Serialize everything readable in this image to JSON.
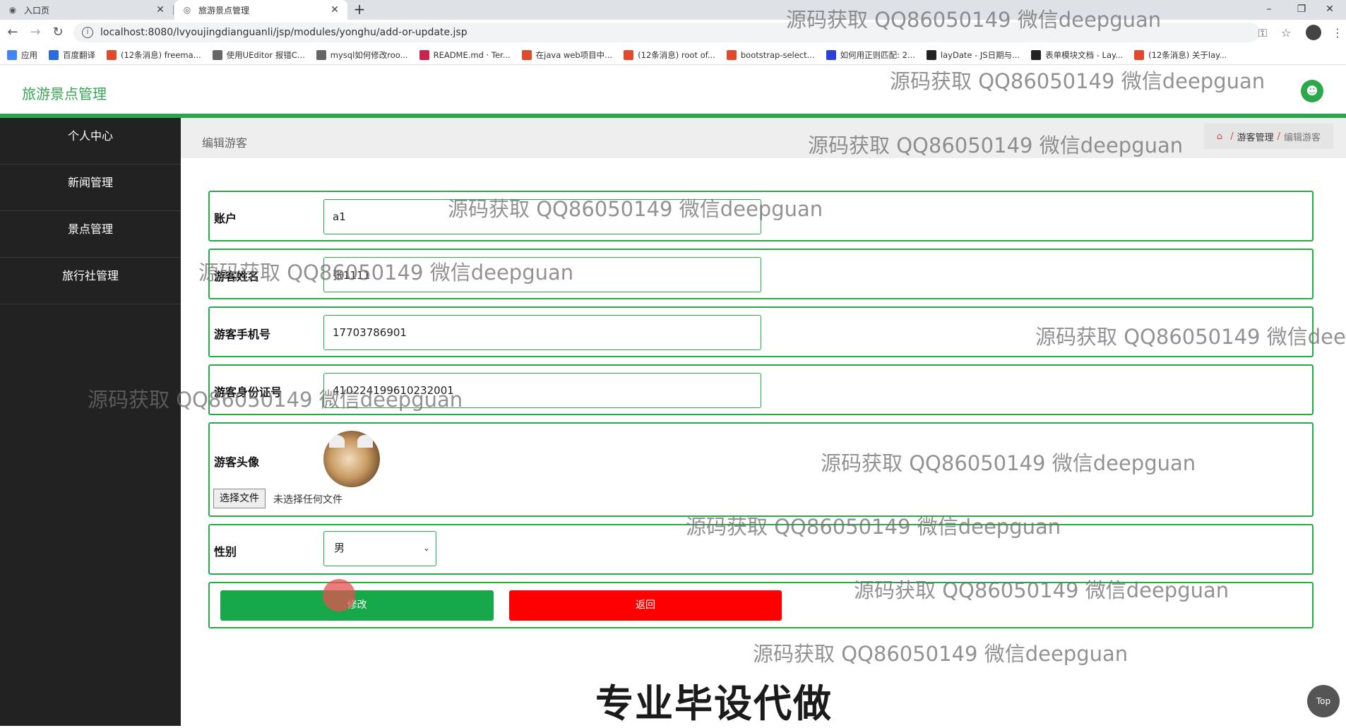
{
  "browser": {
    "tabs": [
      {
        "title": "入口页",
        "active": false
      },
      {
        "title": "旅游景点管理",
        "active": true
      }
    ],
    "url": "localhost:8080/lvyoujingdianguanli/jsp/modules/yonghu/add-or-update.jsp",
    "bookmarks": [
      {
        "label": "应用",
        "color": "#4285f4"
      },
      {
        "label": "百度翻译",
        "color": "#2c6bd9"
      },
      {
        "label": "(12条消息) freema...",
        "color": "#e0492b"
      },
      {
        "label": "使用UEditor 报错C...",
        "color": "#666666"
      },
      {
        "label": "mysql如何修改roo...",
        "color": "#666666"
      },
      {
        "label": "README.md · Ter...",
        "color": "#c7254e"
      },
      {
        "label": "在java web项目中...",
        "color": "#e0492b"
      },
      {
        "label": "(12条消息) root of...",
        "color": "#e0492b"
      },
      {
        "label": "bootstrap-select...",
        "color": "#e0492b"
      },
      {
        "label": "如何用正则匹配: 2...",
        "color": "#2c3fd9"
      },
      {
        "label": "layDate - JS日期与...",
        "color": "#222222"
      },
      {
        "label": "表单模块文档 - Lay...",
        "color": "#222222"
      },
      {
        "label": "(12条消息) 关于lay...",
        "color": "#e0492b"
      }
    ]
  },
  "app": {
    "title": "旅游景点管理",
    "accent": "#27a74a"
  },
  "sidebar": {
    "items": [
      {
        "label": "个人中心"
      },
      {
        "label": "新闻管理"
      },
      {
        "label": "景点管理"
      },
      {
        "label": "旅行社管理"
      }
    ]
  },
  "breadcrumb": {
    "page_title": "编辑游客",
    "parent": "游客管理",
    "current": "编辑游客",
    "separator": "/"
  },
  "form": {
    "account": {
      "label": "账户",
      "value": "a1"
    },
    "name": {
      "label": "游客姓名",
      "value": "张1111"
    },
    "phone": {
      "label": "游客手机号",
      "value": "17703786901"
    },
    "idcard": {
      "label": "游客身份证号",
      "value": "410224199610232001"
    },
    "avatar": {
      "label": "游客头像",
      "file_button": "选择文件",
      "file_status": "未选择任何文件"
    },
    "gender": {
      "label": "性别",
      "value": "男"
    },
    "buttons": {
      "save": "修改",
      "back": "返回"
    }
  },
  "top_button": "Top",
  "watermark": "源码获取 QQ86050149 微信deepguan",
  "promo": "专业毕设代做"
}
